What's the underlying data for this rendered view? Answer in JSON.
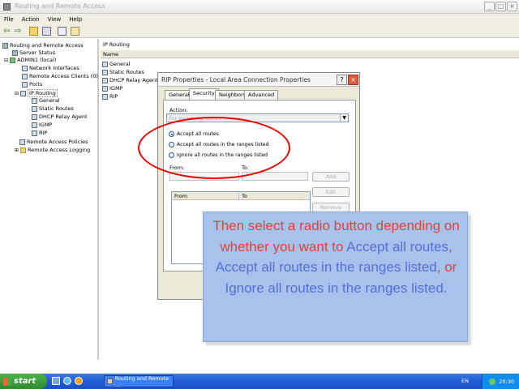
{
  "window": {
    "title": "Routing and Remote Access"
  },
  "menu": [
    "File",
    "Action",
    "View",
    "Help"
  ],
  "tree": {
    "root": "Routing and Remote Access",
    "server_status": "Server Status",
    "server": "ADMIN1 (local)",
    "network_interfaces": "Network Interfaces",
    "remote_access_clients": "Remote Access Clients (0)",
    "ports": "Ports",
    "ip_routing": "IP Routing",
    "general": "General",
    "static_routes": "Static Routes",
    "dhcp_relay_agent": "DHCP Relay Agent",
    "igmp": "IGMP",
    "rip": "RIP",
    "remote_access_policies": "Remote Access Policies",
    "remote_access_logging": "Remote Access Logging"
  },
  "right_pane": {
    "header": "IP Routing",
    "column": "Name",
    "items": [
      "General",
      "Static Routes",
      "DHCP Relay Agent",
      "IGMP",
      "RIP"
    ]
  },
  "dialog": {
    "title": "RIP Properties - Local Area Connection Properties",
    "tabs": [
      "General",
      "Security",
      "Neighbors",
      "Advanced"
    ],
    "action_label": "Action:",
    "action_value": "For incoming routes",
    "radios": [
      "Accept all routes",
      "Accept all routes in the ranges listed",
      "Ignore all routes in the ranges listed"
    ],
    "from_label": "From:",
    "to_label": "To:",
    "add_button": "Add",
    "edit_button": "Edit",
    "remove_button": "Remove",
    "list_headers": [
      "From",
      "To"
    ]
  },
  "callout": {
    "part1": "Then select a radio button depending on whether you want to ",
    "part2": "Accept all routes",
    "part3": ", ",
    "part4": "Accept all routes in the ranges listed",
    "part5": ", or ",
    "part6": "Ignore all routes in the ranges listed",
    "part7": "."
  },
  "taskbar": {
    "start": "start",
    "task": "Routing and Remote ...",
    "lang": "EN",
    "time": "20:30"
  },
  "colors": {
    "callout_bg": "#a7c2ec",
    "callout_red": "#e34236",
    "callout_blue": "#5470d6",
    "ellipse": "#e00000"
  }
}
